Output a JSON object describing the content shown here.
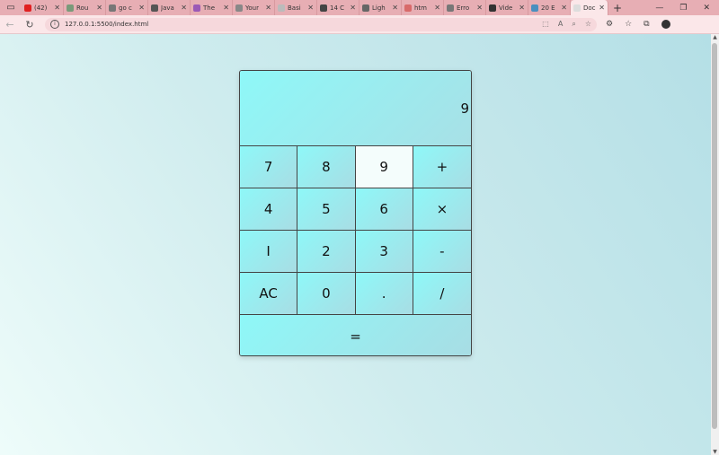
{
  "browser": {
    "tabs": [
      {
        "title": "(42)",
        "color": "#e02020"
      },
      {
        "title": "Rou",
        "color": "#7a9a7a"
      },
      {
        "title": "go c",
        "color": "#777777"
      },
      {
        "title": "Java",
        "color": "#555555"
      },
      {
        "title": "The",
        "color": "#9b59b6"
      },
      {
        "title": "Your",
        "color": "#888888"
      },
      {
        "title": "Basi",
        "color": "#bbbbbb"
      },
      {
        "title": "14 C",
        "color": "#444444"
      },
      {
        "title": "Ligh",
        "color": "#666666"
      },
      {
        "title": "htm",
        "color": "#d86a6a"
      },
      {
        "title": "Erro",
        "color": "#777777"
      },
      {
        "title": "Vide",
        "color": "#333333"
      },
      {
        "title": "20 E",
        "color": "#4a8fbf"
      },
      {
        "title": "Doc",
        "color": "#dddddd",
        "active": true
      }
    ],
    "url": "127.0.0.1:5500/index.html"
  },
  "calculator": {
    "display": "9",
    "keys": [
      "7",
      "8",
      "9",
      "+",
      "4",
      "5",
      "6",
      "×",
      "I",
      "2",
      "3",
      "-",
      "AC",
      "0",
      ".",
      "/"
    ],
    "equals": "="
  }
}
